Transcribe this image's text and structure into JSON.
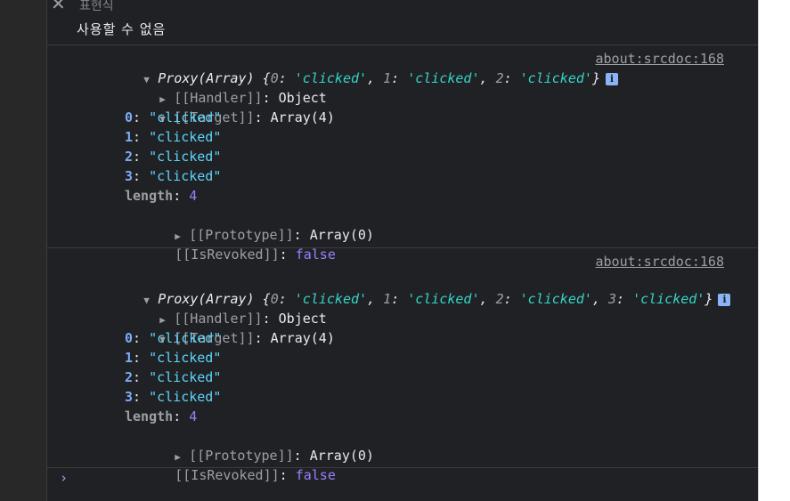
{
  "watch": {
    "title": "표현식",
    "value": "사용할 수 없음"
  },
  "messages": [
    {
      "source": "about:srcdoc:168",
      "summary": {
        "label": "Proxy(Array)",
        "items": [
          {
            "key": "0",
            "value": "'clicked'"
          },
          {
            "key": "1",
            "value": "'clicked'"
          },
          {
            "key": "2",
            "value": "'clicked'"
          }
        ]
      },
      "handler": {
        "key": "[[Handler]]",
        "value": "Object"
      },
      "target": {
        "key": "[[Target]]",
        "value": "Array(4)"
      },
      "entries": [
        {
          "key": "0",
          "value": "\"clicked\""
        },
        {
          "key": "1",
          "value": "\"clicked\""
        },
        {
          "key": "2",
          "value": "\"clicked\""
        },
        {
          "key": "3",
          "value": "\"clicked\""
        }
      ],
      "length": {
        "key": "length",
        "value": "4"
      },
      "prototype": {
        "key": "[[Prototype]]",
        "value": "Array(0)"
      },
      "revoked": {
        "key": "[[IsRevoked]]",
        "value": "false"
      }
    },
    {
      "source": "about:srcdoc:168",
      "summary": {
        "label": "Proxy(Array)",
        "items": [
          {
            "key": "0",
            "value": "'clicked'"
          },
          {
            "key": "1",
            "value": "'clicked'"
          },
          {
            "key": "2",
            "value": "'clicked'"
          },
          {
            "key": "3",
            "value": "'clicked'"
          }
        ]
      },
      "handler": {
        "key": "[[Handler]]",
        "value": "Object"
      },
      "target": {
        "key": "[[Target]]",
        "value": "Array(4)"
      },
      "entries": [
        {
          "key": "0",
          "value": "\"clicked\""
        },
        {
          "key": "1",
          "value": "\"clicked\""
        },
        {
          "key": "2",
          "value": "\"clicked\""
        },
        {
          "key": "3",
          "value": "\"clicked\""
        }
      ],
      "length": {
        "key": "length",
        "value": "4"
      },
      "prototype": {
        "key": "[[Prototype]]",
        "value": "Array(0)"
      },
      "revoked": {
        "key": "[[IsRevoked]]",
        "value": "false"
      }
    }
  ],
  "prompt": {
    "symbol": "›"
  },
  "icons": {
    "close": "close-icon",
    "info": "info-icon",
    "expand": "triangle-icon"
  }
}
